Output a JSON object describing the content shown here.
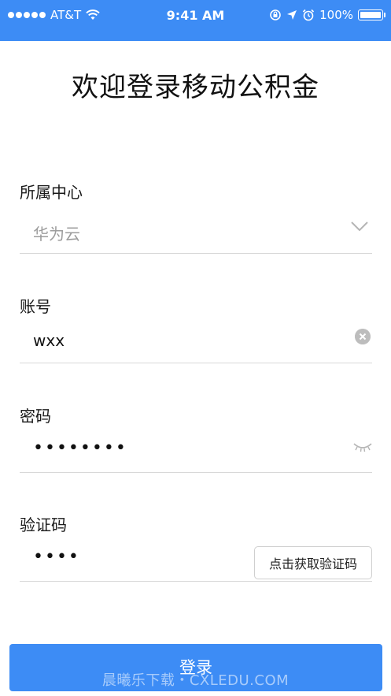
{
  "status_bar": {
    "carrier": "AT&T",
    "time": "9:41 AM",
    "battery": "100%",
    "signal_icon": "signal-dots-icon",
    "wifi_icon": "wifi-icon",
    "rotation_lock_icon": "rotation-lock-icon",
    "location_icon": "location-arrow-icon",
    "alarm_icon": "alarm-clock-icon",
    "battery_icon": "battery-icon"
  },
  "title": "欢迎登录移动公积金",
  "form": {
    "center": {
      "label": "所属中心",
      "value": "华为云",
      "icon": "chevron-down-icon"
    },
    "account": {
      "label": "账号",
      "value": "wxx",
      "icon": "clear-circle-icon"
    },
    "password": {
      "label": "密码",
      "value": "••••••••",
      "icon": "eye-closed-icon"
    },
    "captcha": {
      "label": "验证码",
      "value": "••••",
      "button_label": "点击获取验证码"
    }
  },
  "submit_label": "登录",
  "watermark": "晨曦乐下载・CXLEDU.COM",
  "colors": {
    "primary": "#3d8cf5",
    "divider": "#d8d8d8",
    "placeholder": "#9c9c9c"
  }
}
